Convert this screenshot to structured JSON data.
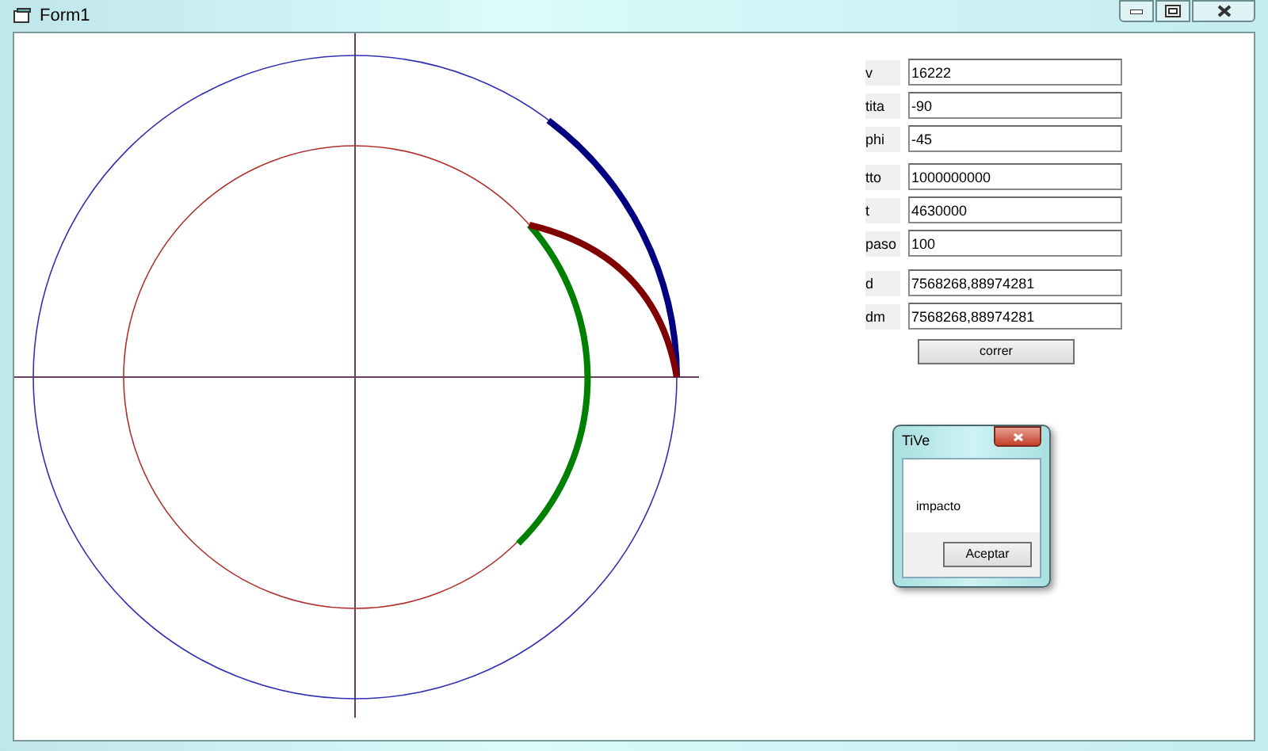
{
  "window": {
    "title": "Form1"
  },
  "fields": [
    {
      "label": "v",
      "value": "16222"
    },
    {
      "label": "tita",
      "value": "-90"
    },
    {
      "label": "phi",
      "value": "-45"
    },
    {
      "label": "tto",
      "value": "1000000000"
    },
    {
      "label": "t",
      "value": "4630000"
    },
    {
      "label": "paso",
      "value": "100"
    },
    {
      "label": "d",
      "value": "7568268,88974281"
    },
    {
      "label": "dm",
      "value": "7568268,88974281"
    }
  ],
  "button": "correr",
  "dialog": {
    "title": "TiVe",
    "message": "impacto",
    "button": "Aceptar"
  }
}
